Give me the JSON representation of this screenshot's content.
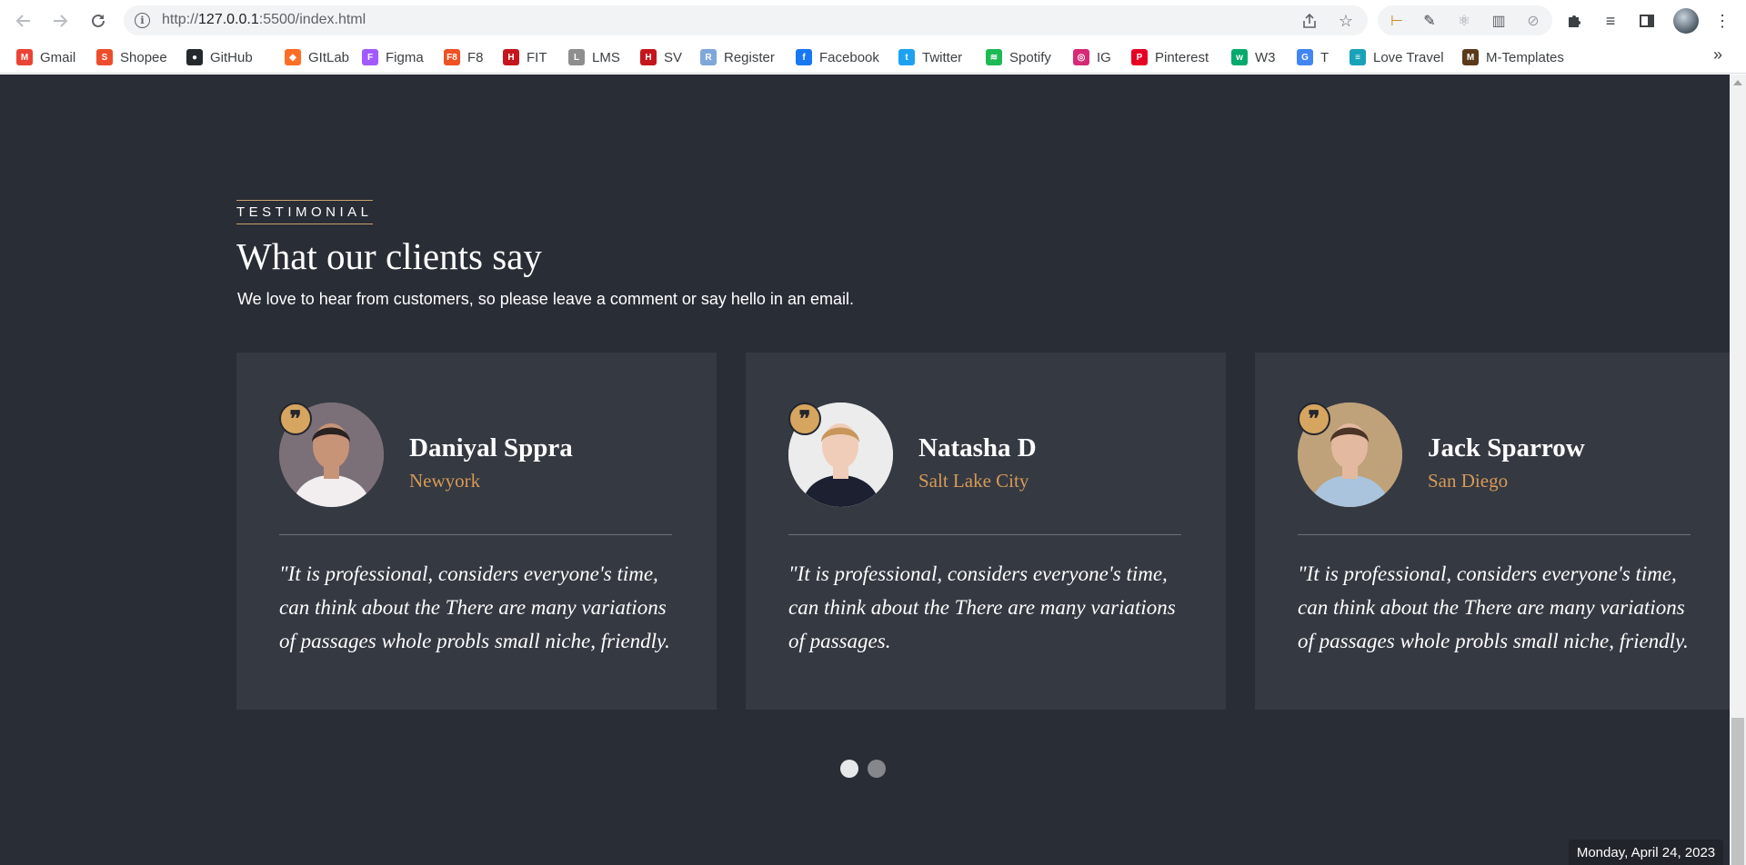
{
  "browser": {
    "url_prefix": "http://",
    "url_host": "127.0.0.1",
    "url_rest": ":5500/index.html",
    "bookmarks": [
      {
        "label": "Gmail",
        "icon": "gmail-icon",
        "color": "#ea4335",
        "glyph": "M"
      },
      {
        "label": "Shopee",
        "icon": "shopee-icon",
        "color": "#ee4d2d",
        "glyph": "S"
      },
      {
        "label": "GitHub",
        "icon": "github-icon",
        "color": "#24292e",
        "glyph": "●"
      },
      {
        "label": "GItLab",
        "icon": "gitlab-icon",
        "color": "#fc6d26",
        "glyph": "◆"
      },
      {
        "label": "Figma",
        "icon": "figma-icon",
        "color": "#a259ff",
        "glyph": "F"
      },
      {
        "label": "F8",
        "icon": "f8-icon",
        "color": "#f05123",
        "glyph": "F8"
      },
      {
        "label": "FIT",
        "icon": "fit-icon",
        "color": "#c4161c",
        "glyph": "H"
      },
      {
        "label": "LMS",
        "icon": "lms-icon",
        "color": "#8e8e8e",
        "glyph": "L"
      },
      {
        "label": "SV",
        "icon": "sv-icon",
        "color": "#c4161c",
        "glyph": "H"
      },
      {
        "label": "Register",
        "icon": "register-icon",
        "color": "#7fa7d9",
        "glyph": "R"
      },
      {
        "label": "Facebook",
        "icon": "facebook-icon",
        "color": "#1877f2",
        "glyph": "f"
      },
      {
        "label": "Twitter",
        "icon": "twitter-icon",
        "color": "#1da1f2",
        "glyph": "t"
      },
      {
        "label": "Spotify",
        "icon": "spotify-icon",
        "color": "#1db954",
        "glyph": "≋"
      },
      {
        "label": "IG",
        "icon": "instagram-icon",
        "color": "#d62976",
        "glyph": "◎"
      },
      {
        "label": "Pinterest",
        "icon": "pinterest-icon",
        "color": "#e60023",
        "glyph": "P"
      },
      {
        "label": "W3",
        "icon": "w3schools-icon",
        "color": "#04aa6d",
        "glyph": "w"
      },
      {
        "label": "T",
        "icon": "translate-icon",
        "color": "#4285f4",
        "glyph": "G"
      },
      {
        "label": "Love Travel",
        "icon": "love-travel-icon",
        "color": "#17a2b8",
        "glyph": "≡"
      },
      {
        "label": "M-Templates",
        "icon": "m-templates-icon",
        "color": "#5a3a1a",
        "glyph": "M"
      }
    ]
  },
  "section": {
    "eyebrow": "TESTIMONIAL",
    "heading": "What our clients say",
    "subheading": "We love to hear from customers, so please leave a comment or say hello in an email."
  },
  "testimonials": [
    {
      "name": "Daniyal Sppra",
      "city": "Newyork",
      "quote": "\"It is professional, considers everyone's time, can think about the There are many variations of passages whole probls small niche, friendly.",
      "avatar_bg": "#7c7078",
      "skin": "#c89478",
      "hair": "#2a2220",
      "shirt": "#f2eef0"
    },
    {
      "name": "Natasha D",
      "city": "Salt Lake City",
      "quote": "\"It is professional, considers everyone's time, can think about the There are many variations of passages.",
      "avatar_bg": "#ececec",
      "skin": "#f0cdb8",
      "hair": "#c8955a",
      "shirt": "#1c2030"
    },
    {
      "name": "Jack Sparrow",
      "city": "San Diego",
      "quote": "\"It is professional, considers everyone's time, can think about the There are many variations of passages whole probls small niche, friendly.",
      "avatar_bg": "#bfa27a",
      "skin": "#e3b9a0",
      "hair": "#4a3426",
      "shirt": "#a9c4dc"
    }
  ],
  "carousel": {
    "slides": 2,
    "active": 1
  },
  "clock": {
    "date": "Monday, April 24, 2023"
  },
  "colors": {
    "page_bg": "#292d36",
    "card_bg": "#353942",
    "accent": "#d6a560",
    "city": "#d69a55"
  }
}
